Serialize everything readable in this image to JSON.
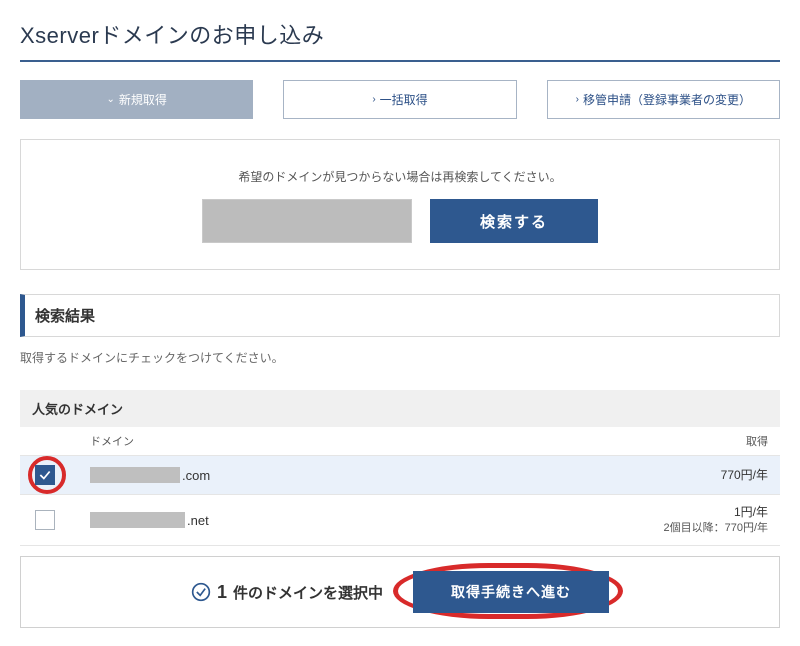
{
  "page_title": "Xserverドメインのお申し込み",
  "tabs": {
    "new": "新規取得",
    "bulk": "一括取得",
    "transfer": "移管申請（登録事業者の変更）"
  },
  "search": {
    "note": "希望のドメインが見つからない場合は再検索してください。",
    "button": "検索する"
  },
  "results_heading": "検索結果",
  "hint": "取得するドメインにチェックをつけてください。",
  "popular_heading": "人気のドメイン",
  "columns": {
    "domain": "ドメイン",
    "price": "取得"
  },
  "rows": [
    {
      "tld": ".com",
      "price": "770円/年",
      "sub": "",
      "checked": true
    },
    {
      "tld": ".net",
      "price": "1円/年",
      "sub": "2個目以降：770円/年",
      "checked": false
    }
  ],
  "footer": {
    "count_num": "1",
    "count_prefix": "",
    "count_suffix": "件のドメインを選択中",
    "proceed": "取得手続きへ進む"
  }
}
